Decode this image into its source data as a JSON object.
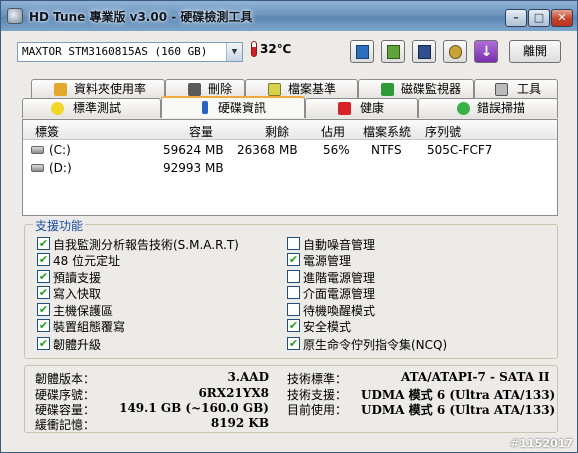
{
  "window": {
    "title": "HD Tune 專業版 v3.00 - 硬碟檢測工具",
    "minimize": "–",
    "maximize": "□",
    "close": "✕"
  },
  "toolbar": {
    "drive": "MAXTOR STM3160815AS (160 GB)",
    "dropdown_arrow": "▼",
    "temperature": "32℃",
    "down_arrow": "↓",
    "exit_label": "離開"
  },
  "tabs_top": [
    {
      "label": "資料夾使用率",
      "icon": "folder-icon"
    },
    {
      "label": "刪除",
      "icon": "trash-icon"
    },
    {
      "label": "檔案基準",
      "icon": "file-benchmark-icon"
    },
    {
      "label": "磁碟監視器",
      "icon": "chart-icon"
    },
    {
      "label": "工具",
      "icon": "speaker-icon"
    }
  ],
  "tabs_bottom": [
    {
      "label": "標準測試",
      "icon": "bulb-icon"
    },
    {
      "label": "硬碟資訊",
      "icon": "info-icon",
      "active": true
    },
    {
      "label": "健康",
      "icon": "health-cross-icon"
    },
    {
      "label": "錯誤掃描",
      "icon": "magnifier-icon"
    }
  ],
  "partitions": {
    "headers": [
      "標簽",
      "容量",
      "剩餘",
      "佔用",
      "檔案系統",
      "序列號"
    ],
    "rows": [
      {
        "label": "(C:)",
        "capacity": "59624 MB",
        "free": "26368 MB",
        "used": "56%",
        "fs": "NTFS",
        "serial": "505C-FCF7"
      },
      {
        "label": "(D:)",
        "capacity": "92993 MB",
        "free": "",
        "used": "",
        "fs": "",
        "serial": ""
      }
    ]
  },
  "features": {
    "title": "支援功能",
    "left": [
      {
        "label": "自我監測分析報告技術(S.M.A.R.T)",
        "checked": true
      },
      {
        "label": "48 位元定址",
        "checked": true
      },
      {
        "label": "預讀支援",
        "checked": true
      },
      {
        "label": "寫入快取",
        "checked": true
      },
      {
        "label": "主機保護區",
        "checked": true
      },
      {
        "label": "裝置組態覆寫",
        "checked": true
      },
      {
        "label": "韌體升級",
        "checked": true
      }
    ],
    "right": [
      {
        "label": "自動噪音管理",
        "checked": false
      },
      {
        "label": "電源管理",
        "checked": true
      },
      {
        "label": "進階電源管理",
        "checked": false
      },
      {
        "label": "介面電源管理",
        "checked": false
      },
      {
        "label": "待機喚醒模式",
        "checked": false
      },
      {
        "label": "安全模式",
        "checked": true
      },
      {
        "label": "原生命令佇列指令集(NCQ)",
        "checked": true
      }
    ],
    "check_mark": "✔"
  },
  "details": {
    "firmware_label": "韌體版本：",
    "firmware_value": "3.AAD",
    "serial_label": "硬碟序號：",
    "serial_value": "6RX21YX8",
    "capacity_label": "硬碟容量：",
    "capacity_value": "149.1 GB (~160.0 GB)",
    "cache_label": "緩衝記憶：",
    "cache_value": "8192 KB",
    "standard_label": "技術標準：",
    "standard_value": "ATA/ATAPI-7 - SATA II",
    "support_label": "技術支援：",
    "support_value": "UDMA 模式 6 (Ultra ATA/133)",
    "current_label": "目前使用：",
    "current_value": "UDMA 模式 6 (Ultra ATA/133)"
  },
  "watermark": "#1152017"
}
